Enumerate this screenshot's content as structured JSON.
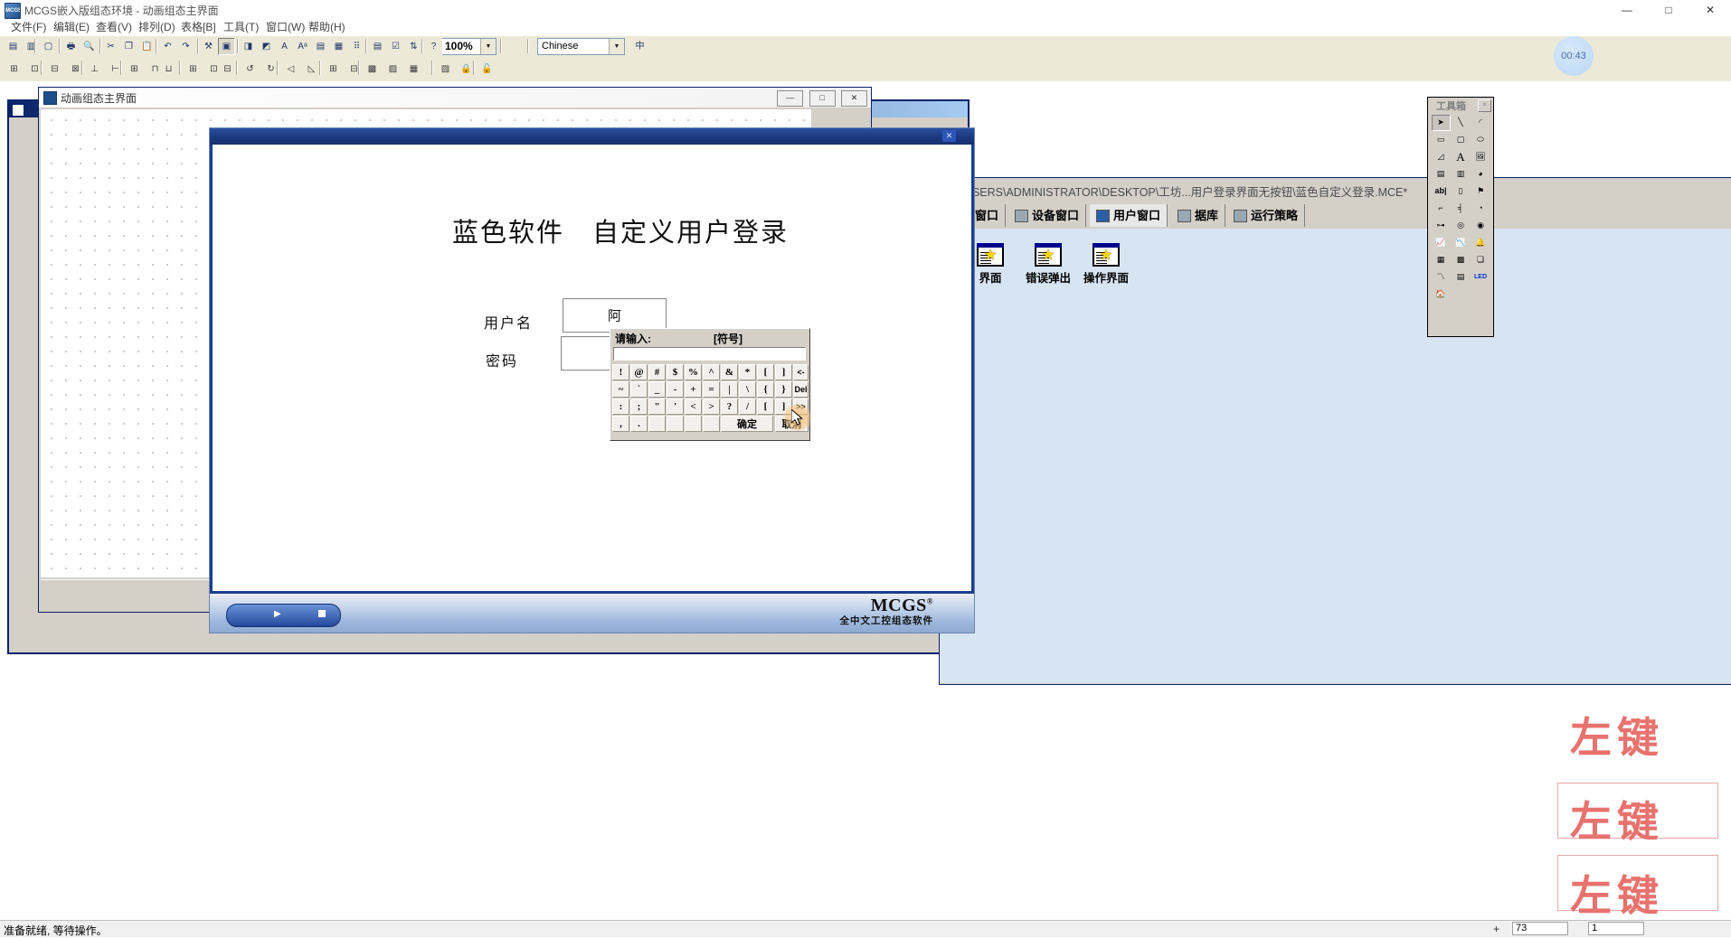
{
  "window": {
    "title": "MCGS嵌入版组态环境 - 动画组态主界面",
    "app_icon": "mcgs-icon",
    "minimize": "—",
    "maximize": "□",
    "close": "✕"
  },
  "menubar": {
    "items": [
      {
        "label": "文件(F)",
        "name": "menu-file"
      },
      {
        "label": "编辑(E)",
        "name": "menu-edit"
      },
      {
        "label": "查看(V)",
        "name": "menu-view"
      },
      {
        "label": "排列(D)",
        "name": "menu-arrange"
      },
      {
        "label": "表格[B]",
        "name": "menu-table"
      },
      {
        "label": "工具(T)",
        "name": "menu-tools"
      },
      {
        "label": "窗口(W)",
        "name": "menu-window"
      },
      {
        "label": "帮助(H)",
        "name": "menu-help"
      }
    ]
  },
  "toolbar1": {
    "zoom_value": "100%",
    "zoom_arrow": "▼",
    "language_value": "Chinese",
    "language_arrow": "▼",
    "buttons": [
      {
        "name": "new-project-icon",
        "glyph": "▤"
      },
      {
        "name": "project-manager-icon",
        "glyph": "▥"
      },
      {
        "name": "save-icon",
        "glyph": "▢"
      },
      {
        "name": "print-icon",
        "glyph": "🖶"
      },
      {
        "name": "print-preview-icon",
        "glyph": "🔍"
      },
      {
        "name": "cut-icon",
        "glyph": "✂"
      },
      {
        "name": "copy-icon",
        "glyph": "❐"
      },
      {
        "name": "paste-icon",
        "glyph": "📋"
      },
      {
        "name": "undo-icon",
        "glyph": "↶"
      },
      {
        "name": "redo-icon",
        "glyph": "↷"
      },
      {
        "name": "tools-icon",
        "glyph": "⚒"
      },
      {
        "name": "window-props-icon",
        "glyph": "▣"
      },
      {
        "name": "fill-color-icon",
        "glyph": "◨"
      },
      {
        "name": "line-color-icon",
        "glyph": "◩"
      },
      {
        "name": "text-bg-icon",
        "glyph": "A"
      },
      {
        "name": "font-icon",
        "glyph": "Aᵃ"
      },
      {
        "name": "align-list-icon",
        "glyph": "▤"
      },
      {
        "name": "paragraph-icon",
        "glyph": "▦"
      },
      {
        "name": "grid-icon",
        "glyph": "⠿"
      },
      {
        "name": "properties-icon",
        "glyph": "▤"
      },
      {
        "name": "check-icon",
        "glyph": "☑"
      },
      {
        "name": "sort-icon",
        "glyph": "⇅"
      },
      {
        "name": "help-pointer-icon",
        "glyph": "?"
      },
      {
        "name": "ime-icon",
        "glyph": "中"
      }
    ]
  },
  "toolbar2": {
    "buttons": [
      {
        "name": "align-left-icon",
        "glyph": "⊞"
      },
      {
        "name": "align-right-icon",
        "glyph": "⊡"
      },
      {
        "name": "align-top-icon",
        "glyph": "⊟"
      },
      {
        "name": "align-bottom-icon",
        "glyph": "⊠"
      },
      {
        "name": "center-horizontal-icon",
        "glyph": "⊥"
      },
      {
        "name": "center-vertical-icon",
        "glyph": "⊢"
      },
      {
        "name": "same-size-icon",
        "glyph": "⊞"
      },
      {
        "name": "same-width-icon",
        "glyph": "⊓"
      },
      {
        "name": "same-height-icon",
        "glyph": "⊔"
      },
      {
        "name": "distribute-h-icon",
        "glyph": "⊞"
      },
      {
        "name": "distribute-v-icon",
        "glyph": "⊡"
      },
      {
        "name": "space-equal-icon",
        "glyph": "⊟"
      },
      {
        "name": "rotate-left-icon",
        "glyph": "↺"
      },
      {
        "name": "rotate-right-icon",
        "glyph": "↻"
      },
      {
        "name": "flip-h-icon",
        "glyph": "◁"
      },
      {
        "name": "flip-v-icon",
        "glyph": "◺"
      },
      {
        "name": "group-icon",
        "glyph": "⊞"
      },
      {
        "name": "ungroup-icon",
        "glyph": "⊟"
      },
      {
        "name": "bring-front-icon",
        "glyph": "▩"
      },
      {
        "name": "send-back-icon",
        "glyph": "▨"
      },
      {
        "name": "layer-up-icon",
        "glyph": "▦"
      },
      {
        "name": "layer-down-icon",
        "glyph": "▧"
      },
      {
        "name": "lock-icon",
        "glyph": "🔒"
      },
      {
        "name": "unlock-icon",
        "glyph": "🔓"
      },
      {
        "name": "dots-icon",
        "glyph": "⠿"
      }
    ]
  },
  "mdi_child": {
    "title": "动画组态主界面",
    "minimize": "—",
    "maximize": "□",
    "close": "✕"
  },
  "project_window": {
    "path": ": C:\\USERS\\ADMINISTRATOR\\DESKTOP\\工坊...用户登录界面无按钮\\蓝色自定义登录.MCE*",
    "tabs": [
      {
        "label": "控窗口",
        "name": "tab-monitor-window",
        "icon": "monitor-icon",
        "active": false
      },
      {
        "label": "设备窗口",
        "name": "tab-device-window",
        "icon": "chip-icon",
        "active": false
      },
      {
        "label": "用户窗口",
        "name": "tab-user-window",
        "icon": "star-window-icon",
        "active": true
      },
      {
        "label": "据库",
        "name": "tab-database",
        "icon": "database-icon",
        "active": false
      },
      {
        "label": "运行策略",
        "name": "tab-run-strategy",
        "icon": "strategy-icon",
        "active": false
      }
    ],
    "window_icons": [
      {
        "label": "界面",
        "name": "user-window-item-1"
      },
      {
        "label": "错误弹出",
        "name": "user-window-item-error-popup"
      },
      {
        "label": "操作界面",
        "name": "user-window-item-operation"
      }
    ]
  },
  "toolbox": {
    "title": "工具箱",
    "close": "×",
    "tools": [
      {
        "name": "select-arrow-tool",
        "glyph": "➤",
        "selected": true
      },
      {
        "name": "line-tool",
        "glyph": "╲"
      },
      {
        "name": "arc-tool",
        "glyph": "◜"
      },
      {
        "name": "rectangle-tool",
        "glyph": "▭"
      },
      {
        "name": "rounded-rect-tool",
        "glyph": "▢"
      },
      {
        "name": "ellipse-tool",
        "glyph": "⬭"
      },
      {
        "name": "polygon-tool",
        "glyph": "◿"
      },
      {
        "name": "text-tool",
        "glyph": "A"
      },
      {
        "name": "picture-tool",
        "glyph": "🖼"
      },
      {
        "name": "insert-element-tool",
        "glyph": "▤"
      },
      {
        "name": "element-lib-tool",
        "glyph": "▥"
      },
      {
        "name": "fill-tool",
        "glyph": "◕"
      },
      {
        "name": "input-box-tool",
        "glyph": "ab|"
      },
      {
        "name": "slider-tool",
        "glyph": "▯"
      },
      {
        "name": "flag-tool",
        "glyph": "⚑"
      },
      {
        "name": "level-tool",
        "glyph": "⌐"
      },
      {
        "name": "bar-tool",
        "glyph": "╡"
      },
      {
        "name": "dial-tool",
        "glyph": "◔"
      },
      {
        "name": "switch-tool",
        "glyph": "⊶"
      },
      {
        "name": "meter-tool",
        "glyph": "◎"
      },
      {
        "name": "indicator-tool",
        "glyph": "◉"
      },
      {
        "name": "realtime-curve-tool",
        "glyph": "📈"
      },
      {
        "name": "history-curve-tool",
        "glyph": "📉"
      },
      {
        "name": "alarm-tool",
        "glyph": "🔔"
      },
      {
        "name": "table-tool",
        "glyph": "▦"
      },
      {
        "name": "report-tool",
        "glyph": "▩"
      },
      {
        "name": "3d-stack-tool",
        "glyph": "❏"
      },
      {
        "name": "trend-tool",
        "glyph": "〽"
      },
      {
        "name": "list-tool",
        "glyph": "▤"
      },
      {
        "name": "led-tool",
        "glyph": "LED"
      },
      {
        "name": "animation-tool",
        "glyph": "🏠"
      }
    ]
  },
  "run_window": {
    "close": "✕",
    "login_title": "蓝色软件　自定义用户登录",
    "username_label": "用户名",
    "username_value": "阿",
    "password_label": "密码",
    "password_value": "",
    "play_glyph": "▶",
    "stop_glyph": "■",
    "logo_text": "MCGS",
    "logo_reg": "®",
    "logo_sub": "全中文工控组态软件"
  },
  "soft_keyboard": {
    "prompt": "请输入:",
    "mode": "[符号]",
    "input_value": "",
    "rows": [
      [
        "!",
        "@",
        "#",
        "$",
        "%",
        "^",
        "&",
        "*",
        "[",
        "]",
        "<-"
      ],
      [
        "~",
        "`",
        "_",
        "-",
        "+",
        "=",
        "|",
        "\\",
        "{",
        "}",
        "Del"
      ],
      [
        ":",
        ";",
        "\"",
        "'",
        "<",
        ">",
        "?",
        "/",
        "[",
        "]",
        ">>"
      ],
      [
        ",",
        ".",
        "",
        "",
        "",
        "",
        "确定",
        "",
        "取消",
        ""
      ]
    ],
    "confirm_label": "确定",
    "cancel_label": "取消"
  },
  "watermarks": {
    "items": [
      "左键",
      "左键",
      "左键"
    ]
  },
  "clock": {
    "time": "00:43"
  },
  "statusbar": {
    "message": "准备就绪, 等待操作。",
    "plus_glyph": "+",
    "field1": "73",
    "field2": "1"
  }
}
